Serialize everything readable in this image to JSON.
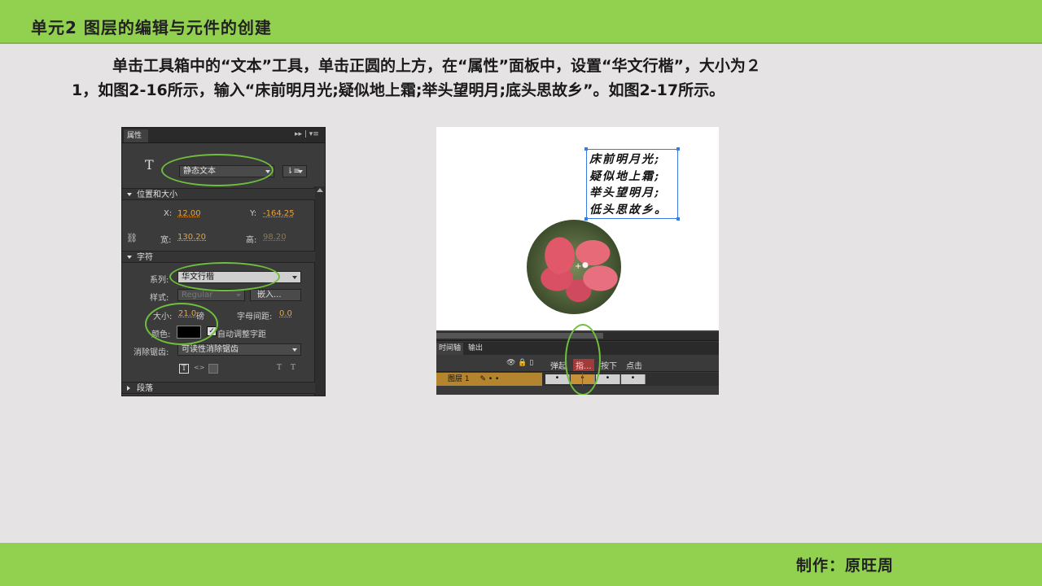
{
  "header": {
    "title": "单元2  图层的编辑与元件的创建"
  },
  "paragraph": {
    "line1": "单击工具箱中的“文本”工具，单击正圆的上方，在“属性”面板中，设置“华文行楷”，大小为２",
    "line2": "1，如图2-16所示，输入“床前明月光;疑似地上霜;举头望明月;底头思故乡”。如图2-17所示。"
  },
  "properties_panel": {
    "tab_label": "属性",
    "panel_controls": "▸▸ | ▾≡",
    "tool_icon": "T",
    "text_type": "静态文本",
    "orientation_glyph": "⇂≡",
    "section_position": "位置和大小",
    "x_label": "X:",
    "x_value": "12.00",
    "y_label": "Y:",
    "y_value": "-164.25",
    "link_glyph": "⛓",
    "width_label": "宽:",
    "width_value": "130.20",
    "height_label": "高:",
    "height_value": "98.20",
    "section_char": "字符",
    "family_label": "系列:",
    "family_value": "华文行楷",
    "style_label": "样式:",
    "style_value": "Regular",
    "embed_button": "嵌入...",
    "size_label": "大小:",
    "size_value": "21.0",
    "size_unit": "磅",
    "spacing_label": "字母间距:",
    "spacing_value": "0.0",
    "color_label": "颜色:",
    "color_value": "#000000",
    "autokern_check": "✓",
    "autokern_label": "自动调整字距",
    "antialias_label": "消除锯齿:",
    "antialias_value": "可读性消除锯齿",
    "icon_t": "T",
    "icon_code": "<>",
    "icon_t2": "T",
    "icon_t3": "T",
    "section_paragraph": "段落"
  },
  "stage": {
    "poem_lines": [
      "床前明月光;",
      "疑似地上霜;",
      "举头望明月;",
      "低头思故乡。"
    ],
    "crosshair": "+",
    "timeline_tab": "时间轴",
    "output_tab": "输出",
    "layer_icons": "👁 🔒 ▯",
    "frame_labels": [
      "弹起",
      "指...",
      "按下",
      "点击"
    ],
    "layer_name": "图层 1",
    "layer_icons_row": "✎ • •",
    "frame_dot": "•"
  },
  "footer": {
    "author": "制作：原旺周"
  },
  "colors": {
    "accent_green": "#92d050",
    "ring_green": "#6fbf3c",
    "panel_bg": "#3b3b3b",
    "value_orange": "#e8a33c"
  }
}
